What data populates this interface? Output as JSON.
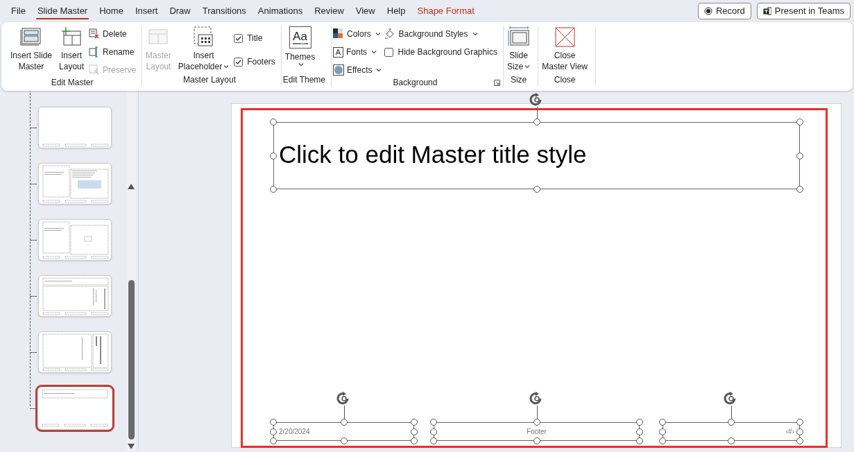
{
  "menu_tabs": [
    {
      "label": "File",
      "selected": false,
      "kind": "normal"
    },
    {
      "label": "Slide Master",
      "selected": true,
      "kind": "normal"
    },
    {
      "label": "Home",
      "selected": false,
      "kind": "normal"
    },
    {
      "label": "Insert",
      "selected": false,
      "kind": "normal"
    },
    {
      "label": "Draw",
      "selected": false,
      "kind": "normal"
    },
    {
      "label": "Transitions",
      "selected": false,
      "kind": "normal"
    },
    {
      "label": "Animations",
      "selected": false,
      "kind": "normal"
    },
    {
      "label": "Review",
      "selected": false,
      "kind": "normal"
    },
    {
      "label": "View",
      "selected": false,
      "kind": "normal"
    },
    {
      "label": "Help",
      "selected": false,
      "kind": "normal"
    },
    {
      "label": "Shape Format",
      "selected": false,
      "kind": "contextual"
    }
  ],
  "top_buttons": [
    {
      "label": "Record",
      "kind": "record"
    },
    {
      "label": "Present in Teams",
      "kind": "teams"
    }
  ],
  "ribbon_groups": [
    {
      "label": "Edit Master",
      "columns": [
        {
          "kind": "large",
          "lines": [
            "Insert Slide",
            "Master"
          ],
          "disabled": false,
          "dropdown": false
        },
        {
          "kind": "large",
          "lines": [
            "Insert",
            "Layout"
          ],
          "disabled": false,
          "dropdown": false
        },
        {
          "kind": "stack",
          "items": [
            {
              "kind": "button",
              "label": "Delete",
              "disabled": false,
              "dropdown": false
            },
            {
              "kind": "button",
              "label": "Rename",
              "disabled": false,
              "dropdown": false
            },
            {
              "kind": "button",
              "label": "Preserve",
              "disabled": true,
              "dropdown": false
            }
          ]
        }
      ]
    },
    {
      "label": "Master Layout",
      "columns": [
        {
          "kind": "large",
          "lines": [
            "Master",
            "Layout"
          ],
          "disabled": true,
          "dropdown": false
        },
        {
          "kind": "large",
          "lines": [
            "Insert",
            "Placeholder"
          ],
          "disabled": false,
          "dropdown": true
        },
        {
          "kind": "stack",
          "items": [
            {
              "kind": "check",
              "label": "Title",
              "checked": true
            },
            {
              "kind": "check",
              "label": "Footers",
              "checked": true
            }
          ]
        }
      ]
    },
    {
      "label": "Edit Theme",
      "columns": [
        {
          "kind": "large",
          "lines": [
            "Themes"
          ],
          "icon_text": "Aa",
          "disabled": false,
          "dropdown": true
        }
      ]
    },
    {
      "label": "Background",
      "launcher": true,
      "columns": [
        {
          "kind": "stack",
          "items": [
            {
              "kind": "button",
              "label": "Colors",
              "disabled": false,
              "dropdown": true
            },
            {
              "kind": "button",
              "label": "Fonts",
              "icon_text": "A",
              "disabled": false,
              "dropdown": true
            },
            {
              "kind": "button",
              "label": "Effects",
              "disabled": false,
              "dropdown": true
            }
          ]
        },
        {
          "kind": "stack",
          "items": [
            {
              "kind": "button",
              "label": "Background Styles",
              "disabled": false,
              "dropdown": true
            },
            {
              "kind": "check",
              "label": "Hide Background Graphics",
              "checked": false
            }
          ]
        }
      ]
    },
    {
      "label": "Size",
      "columns": [
        {
          "kind": "large",
          "lines": [
            "Slide",
            "Size"
          ],
          "disabled": false,
          "dropdown": true
        }
      ]
    },
    {
      "label": "Close",
      "columns": [
        {
          "kind": "large",
          "lines": [
            "Close",
            "Master View"
          ],
          "disabled": false,
          "dropdown": false
        }
      ]
    }
  ],
  "thumbnails": [
    {
      "kind": "blank",
      "selected": false
    },
    {
      "kind": "content_caption",
      "selected": false
    },
    {
      "kind": "picture_caption",
      "selected": false
    },
    {
      "kind": "vertical_text",
      "selected": false
    },
    {
      "kind": "vertical_title",
      "selected": false
    },
    {
      "kind": "title_only",
      "selected": true
    }
  ],
  "slide": {
    "title": "Click to edit Master title style",
    "date": "2/20/2024",
    "footer": "Footer",
    "slide_number": "‹#›",
    "selected": true
  }
}
